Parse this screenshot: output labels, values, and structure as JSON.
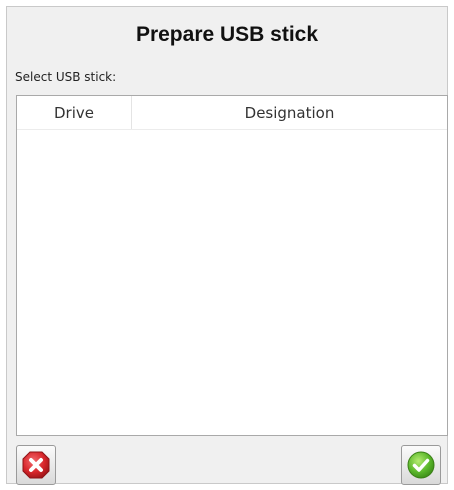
{
  "dialog": {
    "title": "Prepare USB stick",
    "select_label": "Select USB stick:"
  },
  "table": {
    "columns": [
      "Drive",
      "Designation"
    ],
    "rows": []
  },
  "buttons": {
    "cancel_icon": "red-x-icon",
    "confirm_icon": "green-check-icon"
  },
  "colors": {
    "cancel": "#d8262b",
    "confirm": "#5cb82c"
  }
}
